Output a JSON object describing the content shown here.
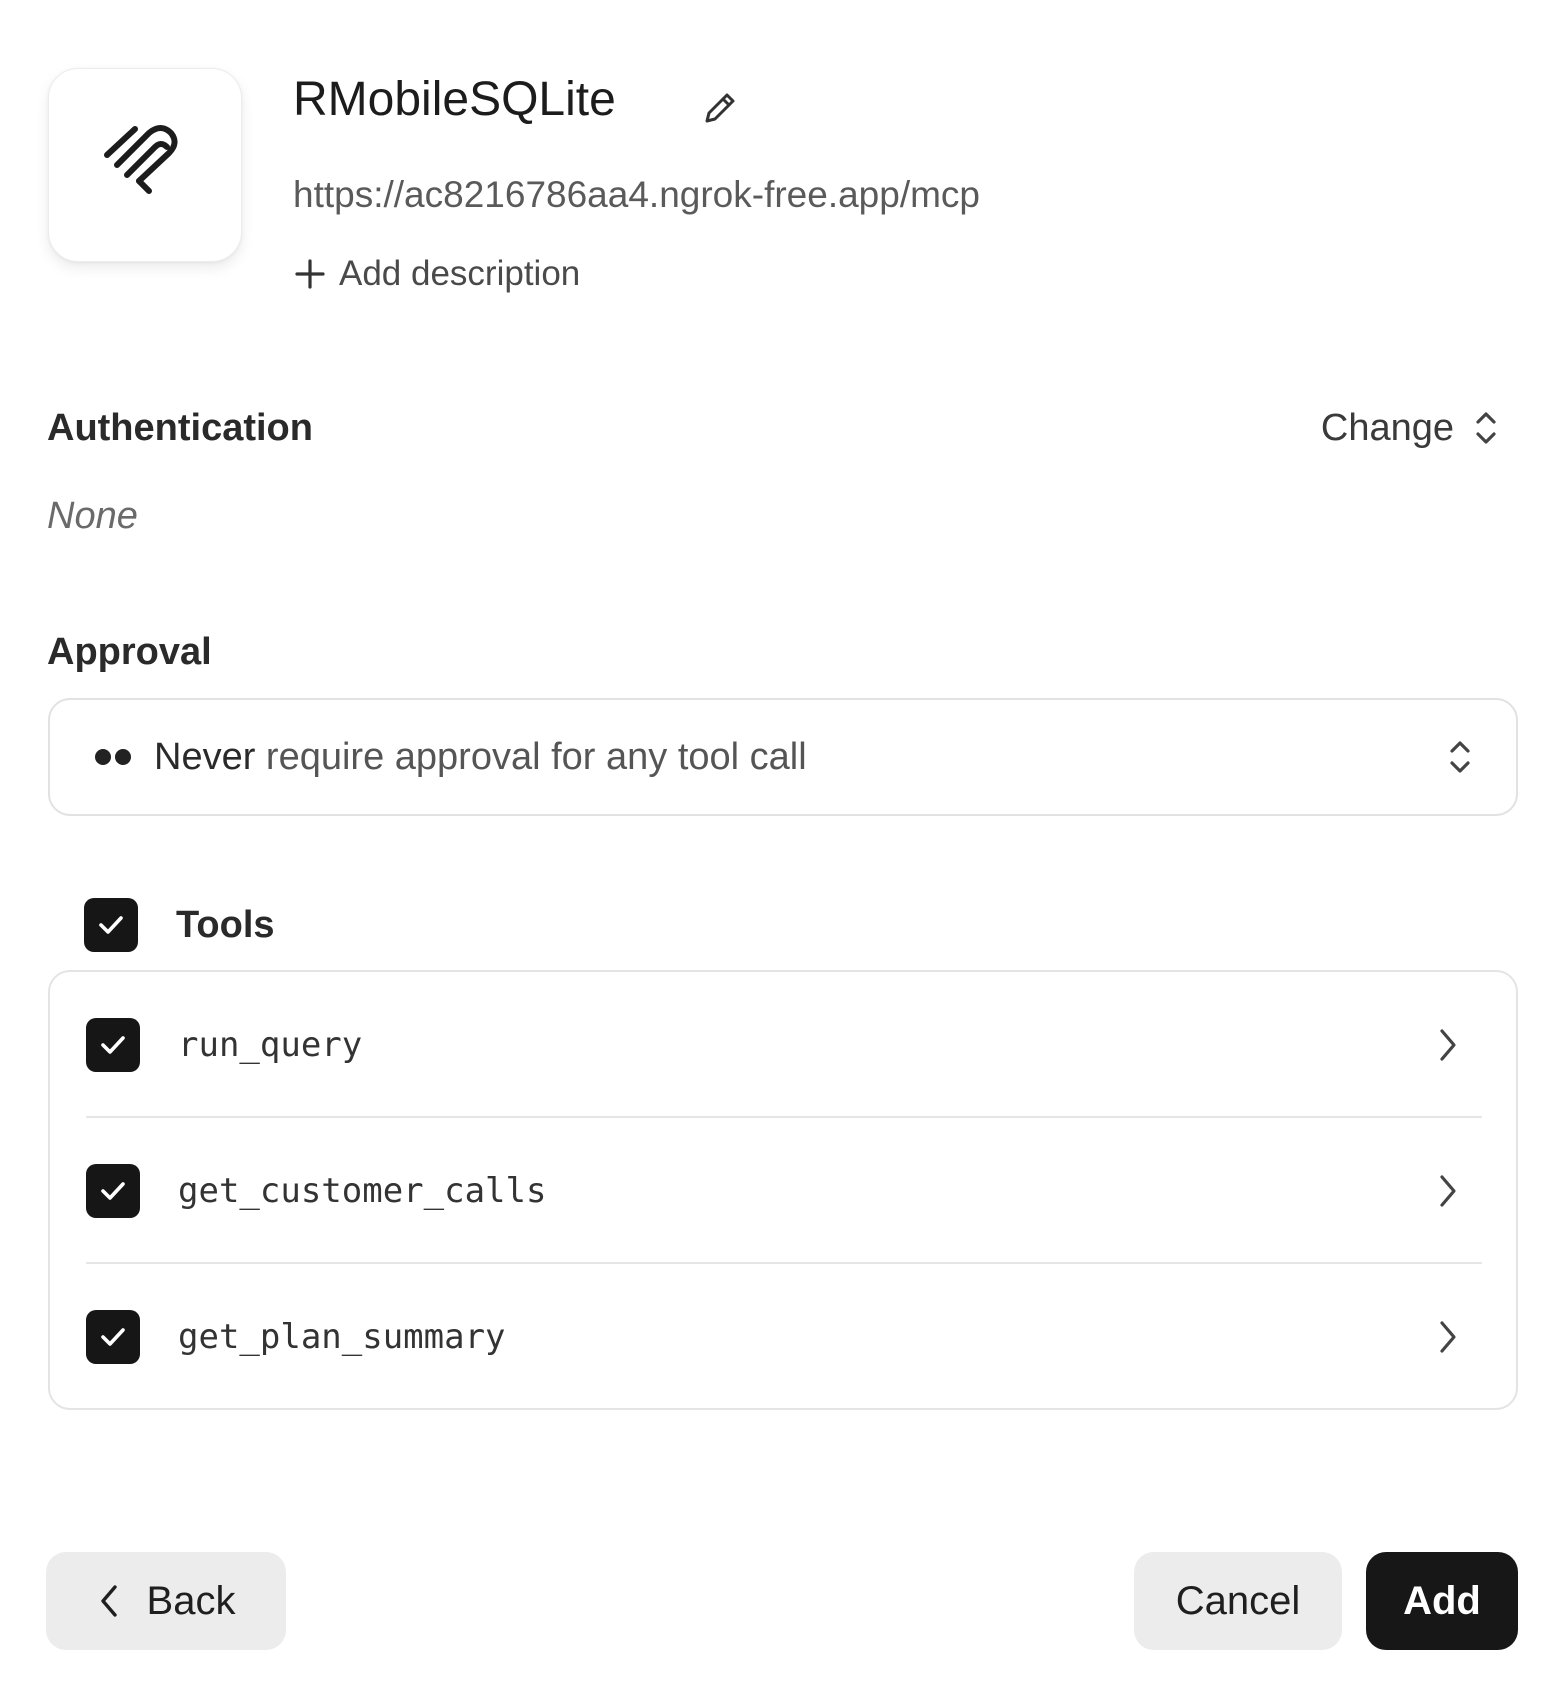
{
  "server": {
    "name": "RMobileSQLite",
    "url": "https://ac8216786aa4.ngrok-free.app/mcp",
    "add_description_label": "Add description",
    "logo_icon": "paperclip-logo-icon",
    "edit_icon": "pencil-icon"
  },
  "authentication": {
    "title": "Authentication",
    "value": "None",
    "change_label": "Change",
    "change_icon": "chevron-up-down-icon"
  },
  "approval": {
    "title": "Approval",
    "selected_emphasis": "Never",
    "selected_rest": " require approval for any tool call",
    "icon": "dots-icon"
  },
  "tools": {
    "label": "Tools",
    "all_checked": true,
    "items": [
      {
        "name": "run_query",
        "checked": true
      },
      {
        "name": "get_customer_calls",
        "checked": true
      },
      {
        "name": "get_plan_summary",
        "checked": true
      }
    ]
  },
  "footer": {
    "back_label": "Back",
    "cancel_label": "Cancel",
    "add_label": "Add"
  },
  "colors": {
    "primary": "#171717",
    "secondary_button": "#ececec",
    "border": "#e2e2e2"
  }
}
